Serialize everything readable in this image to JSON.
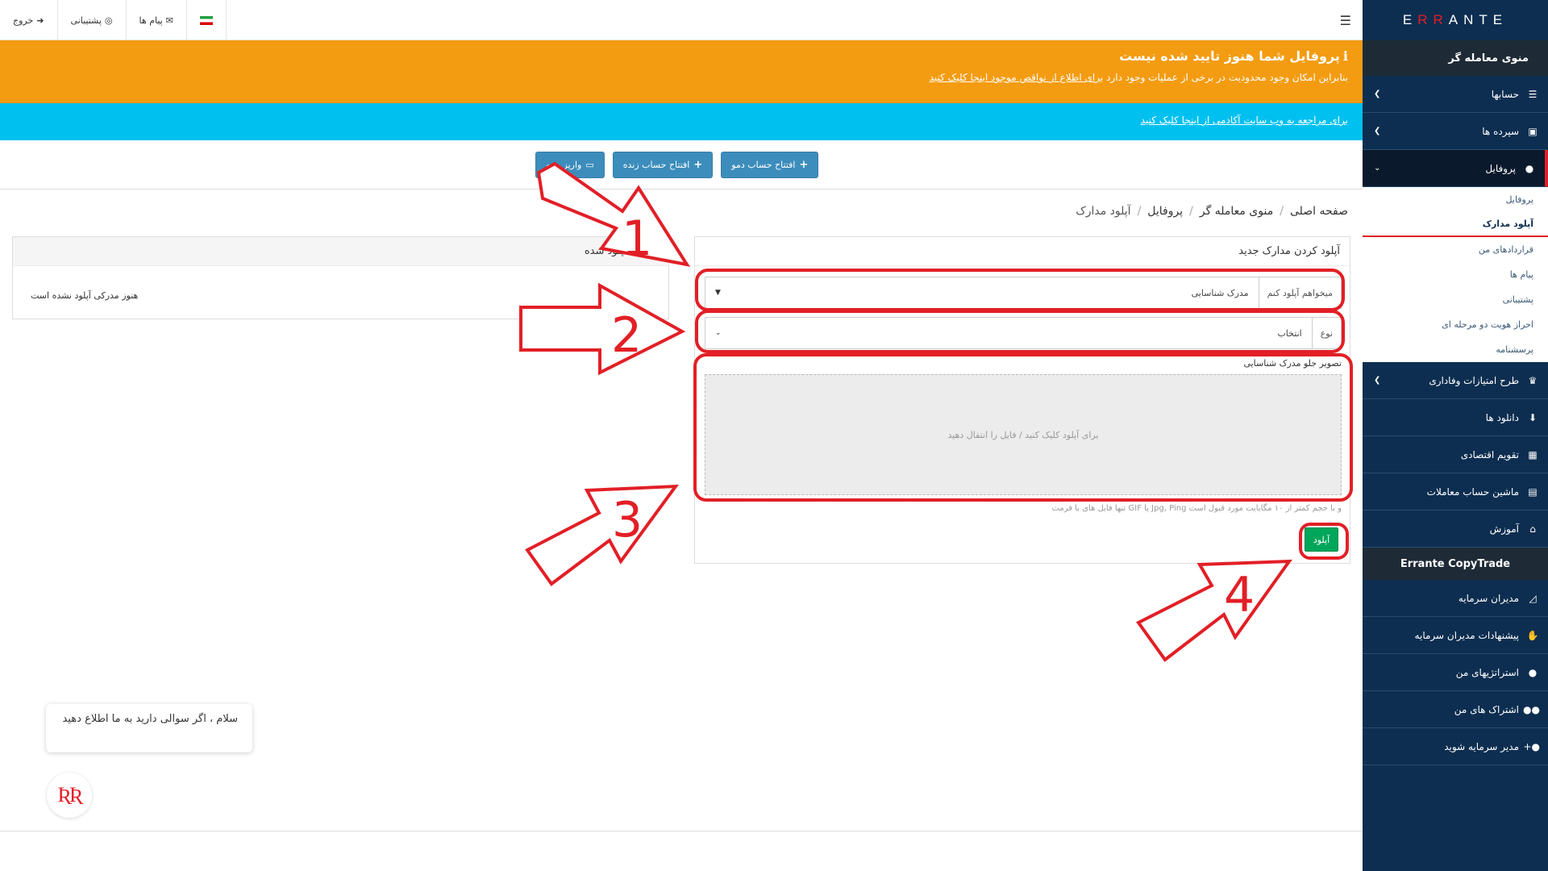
{
  "sidebar": {
    "logo_prefix": "E",
    "logo_rr": "RR",
    "logo_suffix": "ANTE",
    "menu_title": "منوی معامله گر",
    "items": [
      {
        "label": "حسابها",
        "icon": "list-icon"
      },
      {
        "label": "سپرده ها",
        "icon": "wallet-icon"
      },
      {
        "label": "پروفایل",
        "icon": "user-icon"
      }
    ],
    "profile_sub": [
      "پروفایل",
      "آپلود مدارک"
    ],
    "other_links": [
      "قراردادهای من",
      "پیام ها",
      "پشتیبانی",
      "احراز هویت دو مرحله ای",
      "پرسشنامه"
    ],
    "items_after": [
      {
        "label": "طرح امتیازات وفاداری",
        "icon": "trophy-icon"
      },
      {
        "label": "دانلود ها",
        "icon": "download-icon"
      },
      {
        "label": "تقویم اقتصادی",
        "icon": "calendar-icon"
      },
      {
        "label": "ماشین حساب معاملات",
        "icon": "calculator-icon"
      },
      {
        "label": "آموزش",
        "icon": "bank-icon"
      }
    ],
    "copytrade_title": "Errante CopyTrade",
    "copytrade_items": [
      {
        "label": "مدیران سرمایه",
        "icon": "chart-icon"
      },
      {
        "label": "پیشنهادات مدیران سرمایه",
        "icon": "handshake-icon"
      },
      {
        "label": "استراتژیهای من",
        "icon": "user-tie-icon"
      },
      {
        "label": "اشتراک های من",
        "icon": "users-icon"
      },
      {
        "label": "مدیر سرمایه شوید",
        "icon": "user-plus-icon"
      }
    ]
  },
  "topbar": {
    "logout": "خروج",
    "support": "پشتیبانی",
    "messages": "پیام ها"
  },
  "banner": {
    "title": "پروفایل شما هنوز تایید شده نیست",
    "msg_prefix": "بنابراین امکان وجود محدودیت در برخی از عملیات وجود دارد",
    "msg_link1": "برای اطلاع از نواقص موجود اینجا کلیک کنید",
    "academy": "برای مراجعه به وب سایت آکادمی از اینجا کلیک کنید"
  },
  "actions": {
    "demo": "افتتاح حساب دمو",
    "live": "افتتاح حساب زنده",
    "deposit": "واریز وجه"
  },
  "breadcrumb": [
    "صفحه اصلی",
    "منوی معامله گر",
    "پروفایل",
    "آپلود مدارک"
  ],
  "upload": {
    "title": "آپلود کردن مدارک جدید",
    "want_label": "میخواهم آپلود کنم",
    "want_value": "مدرک شناسایی",
    "type_label": "نوع",
    "type_value": "انتخاب",
    "image_label": "تصویر جلو مدرک شناسایی",
    "drop_text": "برای آپلود کلیک کنید / فایل را انتقال دهید",
    "hint": "و با حجم کمتر از ۱۰ مگابایت مورد قبول است Jpg, Ping یا GIF تنها فایل های با فرمت",
    "button": "آپلود"
  },
  "docs": {
    "title": "مدارک آپلود شده",
    "empty": "هنوز مدرکی آپلود نشده است"
  },
  "annotations": [
    "1",
    "2",
    "3",
    "4"
  ],
  "chat": {
    "message": "سلام ، اگر سوالی دارید به ما اطلاع دهید"
  },
  "colors": {
    "sidebar": "#0d2e50",
    "orange": "#f39c12",
    "cyan": "#00c0ef",
    "button_blue": "#3c8dbc",
    "upload_green": "#00a65a",
    "annotation_red": "#e21f26"
  }
}
